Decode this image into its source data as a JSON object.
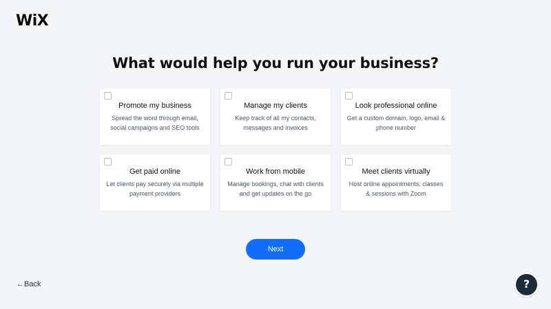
{
  "brand": {
    "logo_text": "WiX"
  },
  "header": {
    "title": "What would help you run your business?"
  },
  "options": [
    {
      "title": "Promote my business",
      "description": "Spread the word through email, social campaigns and SEO tools",
      "checked": false
    },
    {
      "title": "Manage my clients",
      "description": "Keep track of all my contacts, messages and invoices",
      "checked": false
    },
    {
      "title": "Look professional online",
      "description": "Get a custom domain, logo, email & phone number",
      "checked": false
    },
    {
      "title": "Get paid online",
      "description": "Let clients pay securely via multiple payment providers",
      "checked": false
    },
    {
      "title": "Work from mobile",
      "description": "Manage bookings, chat with clients and get updates on the go",
      "checked": false
    },
    {
      "title": "Meet clients virtually",
      "description": "Host online appointments, classes & sessions with Zoom",
      "checked": false
    }
  ],
  "actions": {
    "next_label": "Next",
    "back_label": "←Back",
    "help_icon": "question-mark-icon",
    "help_symbol": "?"
  },
  "colors": {
    "accent": "#116dff",
    "background": "#f4f5f7",
    "card": "#ffffff",
    "help_button": "#1b2b3a"
  }
}
